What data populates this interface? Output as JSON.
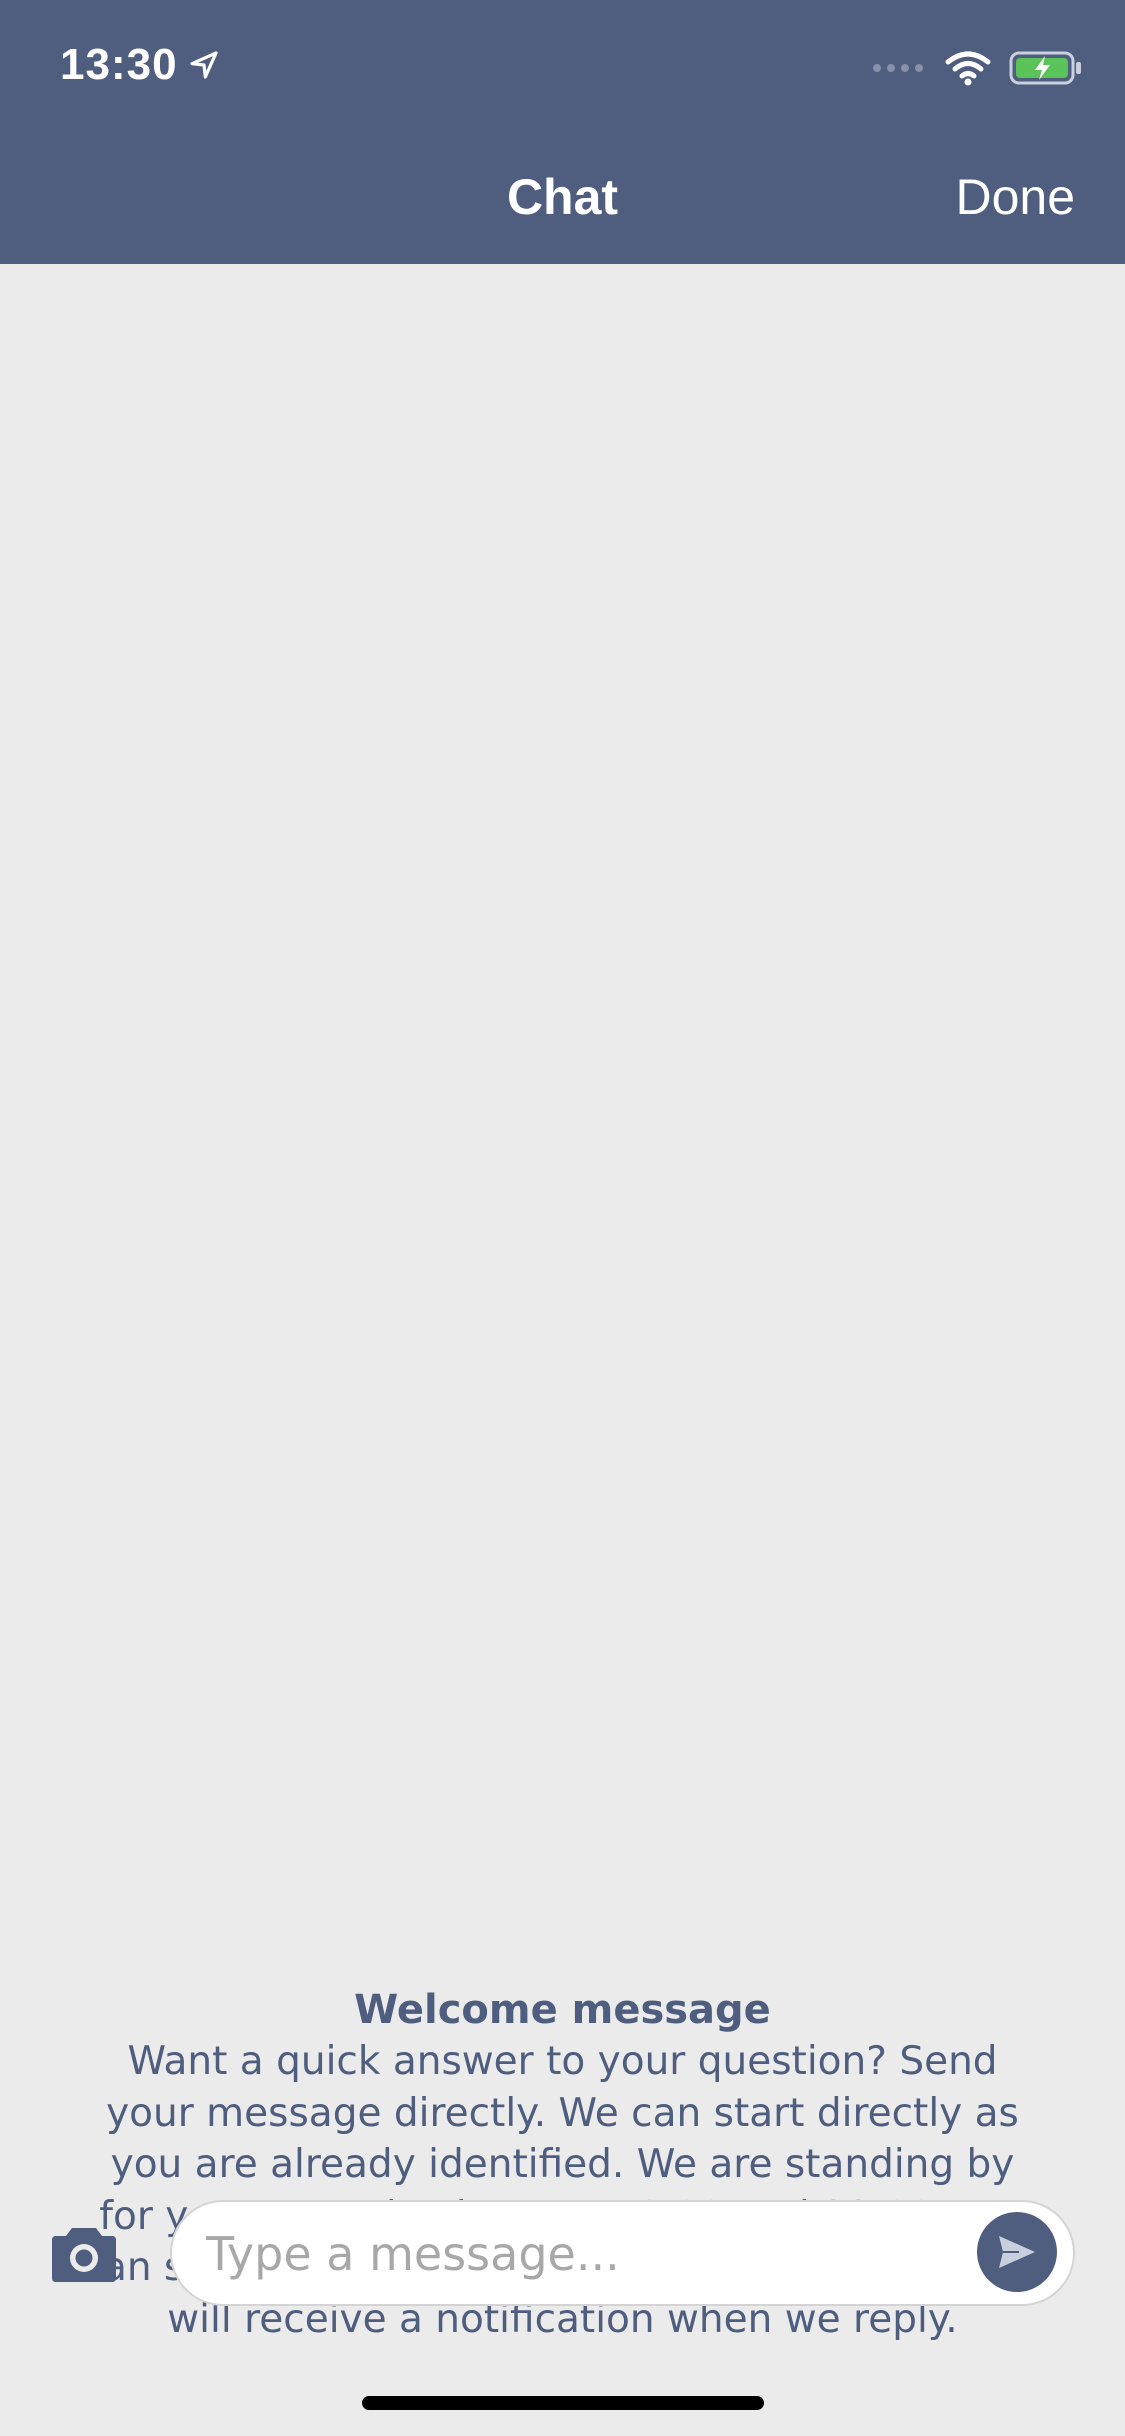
{
  "status_bar": {
    "time": "13:30",
    "icons": [
      "location-arrow-icon",
      "signal-dots-icon",
      "wifi-icon",
      "battery-charging-icon"
    ],
    "battery_color": "#5ac35a"
  },
  "nav": {
    "title": "Chat",
    "done_label": "Done"
  },
  "welcome": {
    "title": "Welcome message",
    "body": "Want a quick answer to your question? Send your message directly. We can start directly as you are already identified. We are standing by for you every day between 8.00 and 22.00. You can safely close the app in the meantime, as you will receive a notification when we reply."
  },
  "composer": {
    "placeholder": "Type a message...",
    "camera_icon": "camera-icon",
    "send_icon": "send-icon"
  },
  "colors": {
    "brand": "#4f5d7e",
    "background": "#ebebeb"
  }
}
